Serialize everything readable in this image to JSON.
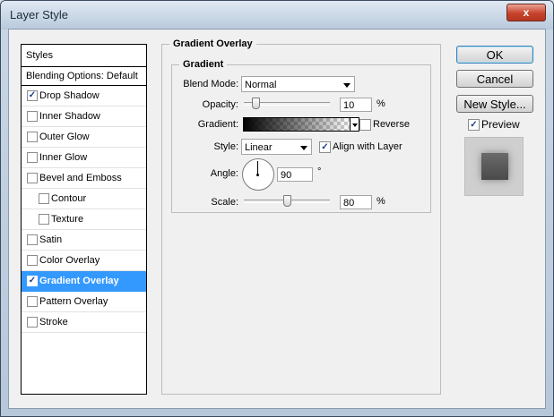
{
  "window": {
    "title": "Layer Style",
    "close_glyph": "x"
  },
  "sidebar": {
    "header": "Styles",
    "blending_options": "Blending Options: Default",
    "items": [
      {
        "label": "Drop Shadow",
        "checked": true,
        "mark": "✓"
      },
      {
        "label": "Inner Shadow",
        "checked": false,
        "mark": ""
      },
      {
        "label": "Outer Glow",
        "checked": false,
        "mark": ""
      },
      {
        "label": "Inner Glow",
        "checked": false,
        "mark": ""
      },
      {
        "label": "Bevel and Emboss",
        "checked": false,
        "mark": ""
      },
      {
        "label": "Contour",
        "checked": false,
        "mark": ""
      },
      {
        "label": "Texture",
        "checked": false,
        "mark": ""
      },
      {
        "label": "Satin",
        "checked": false,
        "mark": ""
      },
      {
        "label": "Color Overlay",
        "checked": false,
        "mark": ""
      },
      {
        "label": "Gradient Overlay",
        "checked": true,
        "mark": "✓",
        "selected": true
      },
      {
        "label": "Pattern Overlay",
        "checked": false,
        "mark": ""
      },
      {
        "label": "Stroke",
        "checked": false,
        "mark": ""
      }
    ]
  },
  "panel": {
    "title": "Gradient Overlay",
    "group": "Gradient",
    "blend_mode_label": "Blend Mode:",
    "blend_mode_value": "Normal",
    "opacity_label": "Opacity:",
    "opacity_value": "10",
    "opacity_unit": "%",
    "opacity_fraction": 0.1,
    "gradient_label": "Gradient:",
    "gradient_colors": [
      "#000000",
      "transparent"
    ],
    "reverse_label": "Reverse",
    "reverse_checked": false,
    "style_label": "Style:",
    "style_value": "Linear",
    "align_label": "Align with Layer",
    "align_checked": true,
    "align_mark": "✓",
    "angle_label": "Angle:",
    "angle_value": "90",
    "angle_unit": "°",
    "scale_label": "Scale:",
    "scale_value": "80",
    "scale_unit": "%",
    "scale_fraction": 0.5
  },
  "buttons": {
    "ok": "OK",
    "cancel": "Cancel",
    "new_style": "New Style..."
  },
  "preview": {
    "label": "Preview",
    "checked": true,
    "mark": "✓"
  },
  "colors": {
    "selected_row": "#3399ff",
    "close_button": "#c7432c"
  }
}
